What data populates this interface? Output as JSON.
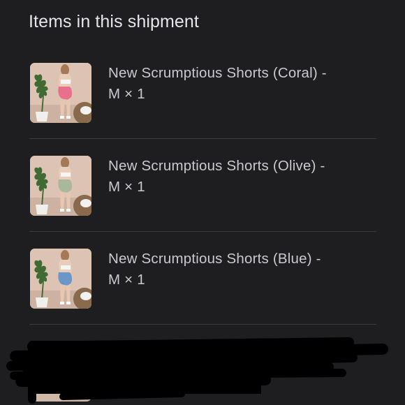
{
  "shipment": {
    "title": "Items in this shipment",
    "items": [
      {
        "name": "New Scrumptious Shorts (Coral) -",
        "variant": "M × 1",
        "shorts_color": "#e8708c"
      },
      {
        "name": "New Scrumptious Shorts (Olive) -",
        "variant": "M × 1",
        "shorts_color": "#a9b79a"
      },
      {
        "name": "New Scrumptious Shorts (Blue) -",
        "variant": "M × 1",
        "shorts_color": "#6b96c8"
      }
    ]
  },
  "colors": {
    "background": "#1e1e21",
    "title_text": "#e6e6ea",
    "item_text": "#c9c9ce",
    "divider": "#3a3a3f",
    "redaction": "#000000"
  }
}
